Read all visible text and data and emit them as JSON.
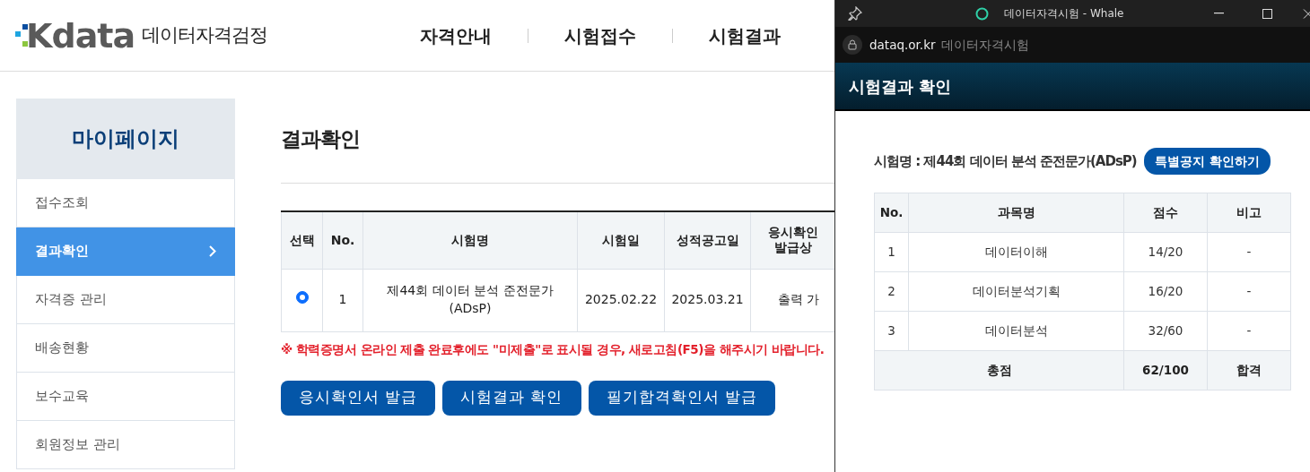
{
  "site": {
    "logo_text": "Kdata",
    "logo_subtitle": "데이터자격검정",
    "nav": [
      "자격안내",
      "시험접수",
      "시험결과"
    ]
  },
  "sidebar": {
    "title": "마이페이지",
    "items": [
      {
        "label": "접수조회",
        "selected": false
      },
      {
        "label": "결과확인",
        "selected": true
      },
      {
        "label": "자격증 관리",
        "selected": false
      },
      {
        "label": "배송현황",
        "selected": false
      },
      {
        "label": "보수교육",
        "selected": false
      },
      {
        "label": "회원정보 관리",
        "selected": false
      }
    ]
  },
  "main": {
    "title": "결과확인",
    "table": {
      "columns": [
        [
          "선택"
        ],
        [
          "No."
        ],
        [
          "시험명"
        ],
        [
          "시험일"
        ],
        [
          "성적공고일"
        ],
        [
          "응시확인",
          "발급상"
        ]
      ],
      "rows": [
        {
          "selected": true,
          "no": "1",
          "name": "제44회 데이터 분석 준전문가 (ADsP)",
          "exam_date": "2025.02.22",
          "result_date": "2025.03.21",
          "status": "출력 가"
        }
      ]
    },
    "notice": "※ 학력증명서 온라인 제출 완료후에도 \"미제출\"로 표시될 경우, 새로고침(F5)을 해주시기 바랍니다.",
    "buttons": [
      "응시확인서 발급",
      "시험결과 확인",
      "필기합격확인서 발급"
    ]
  },
  "popup": {
    "window_title": "데이터자격시험 - Whale",
    "url": "dataq.or.kr",
    "page_title_in_bar": "데이터자격시험",
    "header": "시험결과 확인",
    "exam_label": "시험명 : 제44회 데이터 분석 준전문가(ADsP)",
    "notice_button": "특별공지 확인하기",
    "table": {
      "columns": [
        "No.",
        "과목명",
        "점수",
        "비고"
      ],
      "rows": [
        {
          "no": "1",
          "subject": "데이터이해",
          "score": "14/20",
          "note": "-"
        },
        {
          "no": "2",
          "subject": "데이터분석기획",
          "score": "16/20",
          "note": "-"
        },
        {
          "no": "3",
          "subject": "데이터분석",
          "score": "32/60",
          "note": "-"
        }
      ],
      "total": {
        "label": "총점",
        "score": "62/100",
        "result": "합격"
      }
    }
  }
}
